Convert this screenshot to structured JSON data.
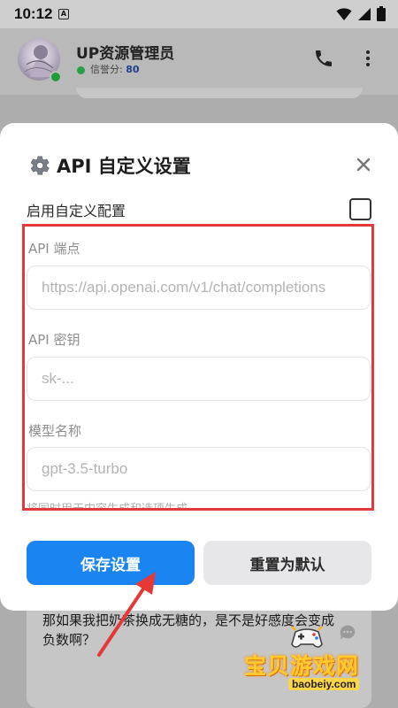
{
  "status_bar": {
    "time": "10:12",
    "notification_badge": "A"
  },
  "chat_header": {
    "name": "UP资源管理员",
    "reputation_label": "信誉分:",
    "reputation_value": "80"
  },
  "modal": {
    "title": "API 自定义设置",
    "enable_label": "启用自定义配置",
    "enable_checked": false,
    "fields": [
      {
        "label": "API 端点",
        "placeholder": "https://api.openai.com/v1/chat/completions",
        "value": ""
      },
      {
        "label": "API 密钥",
        "placeholder": "sk-...",
        "value": ""
      },
      {
        "label": "模型名称",
        "placeholder": "gpt-3.5-turbo",
        "value": ""
      }
    ],
    "hint": "将同时用于内容生成和选项生成",
    "save_label": "保存设置",
    "reset_label": "重置为默认"
  },
  "chat_message": "那如果我把奶茶换成无糖的，是不是好感度会变成负数啊？",
  "watermark": {
    "title": "宝贝游戏网",
    "url": "baobeiy.com"
  },
  "colors": {
    "primary": "#1a84f0",
    "highlight": "#e23a3a",
    "online": "#1f9d3a"
  },
  "icons": [
    "gear-icon",
    "close-icon",
    "phone-icon",
    "more-icon",
    "wifi-icon",
    "signal-icon",
    "battery-icon",
    "chat-bubble-icon"
  ]
}
